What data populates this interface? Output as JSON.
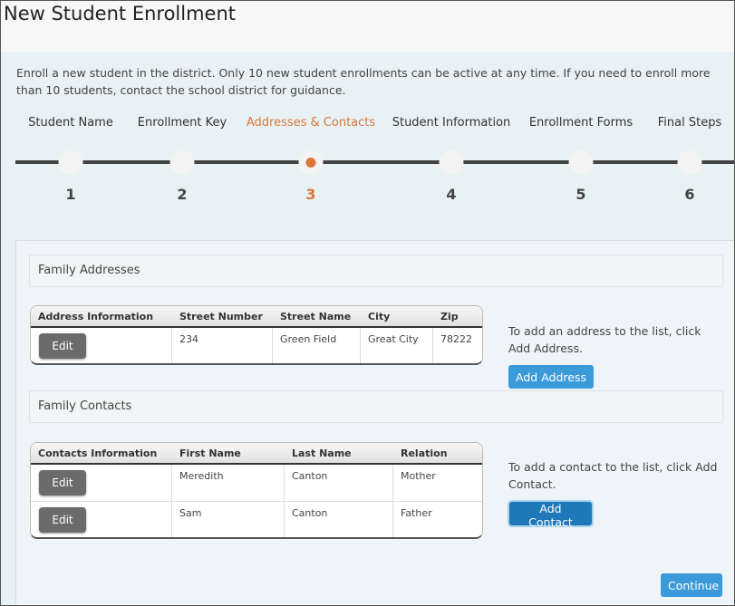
{
  "page": {
    "title": "New Student Enrollment",
    "intro": "Enroll a new student in the district. Only 10 new student enrollments can be active at any time. If you need to enroll more than 10 students, contact the school district for guidance."
  },
  "steps": [
    {
      "label": "Student Name",
      "number": "1",
      "active": false
    },
    {
      "label": "Enrollment Key",
      "number": "2",
      "active": false
    },
    {
      "label": "Addresses & Contacts",
      "number": "3",
      "active": true
    },
    {
      "label": "Student Information",
      "number": "4",
      "active": false
    },
    {
      "label": "Enrollment Forms",
      "number": "5",
      "active": false
    },
    {
      "label": "Final Steps",
      "number": "6",
      "active": false
    }
  ],
  "addresses": {
    "section_title": "Family Addresses",
    "columns": [
      "Address Information",
      "Street Number",
      "Street Name",
      "City",
      "Zip"
    ],
    "rows": [
      {
        "edit_label": "Edit",
        "street_number": "234",
        "street_name": "Green Field",
        "city": "Great City",
        "zip": "78222"
      }
    ],
    "hint": "To add an address to the list, click Add Address.",
    "add_label": "Add Address"
  },
  "contacts": {
    "section_title": "Family Contacts",
    "columns": [
      "Contacts Information",
      "First Name",
      "Last Name",
      "Relation"
    ],
    "rows": [
      {
        "edit_label": "Edit",
        "first_name": "Meredith",
        "last_name": "Canton",
        "relation": "Mother"
      },
      {
        "edit_label": "Edit",
        "first_name": "Sam",
        "last_name": "Canton",
        "relation": "Father"
      }
    ],
    "hint": "To add a contact to the list, click Add Contact.",
    "add_label": "Add Contact"
  },
  "footer": {
    "continue_label": "Continue"
  },
  "colors": {
    "active_step": "#d9773b",
    "primary_button": "#3b9ad9",
    "edit_button": "#6b6b6b"
  }
}
